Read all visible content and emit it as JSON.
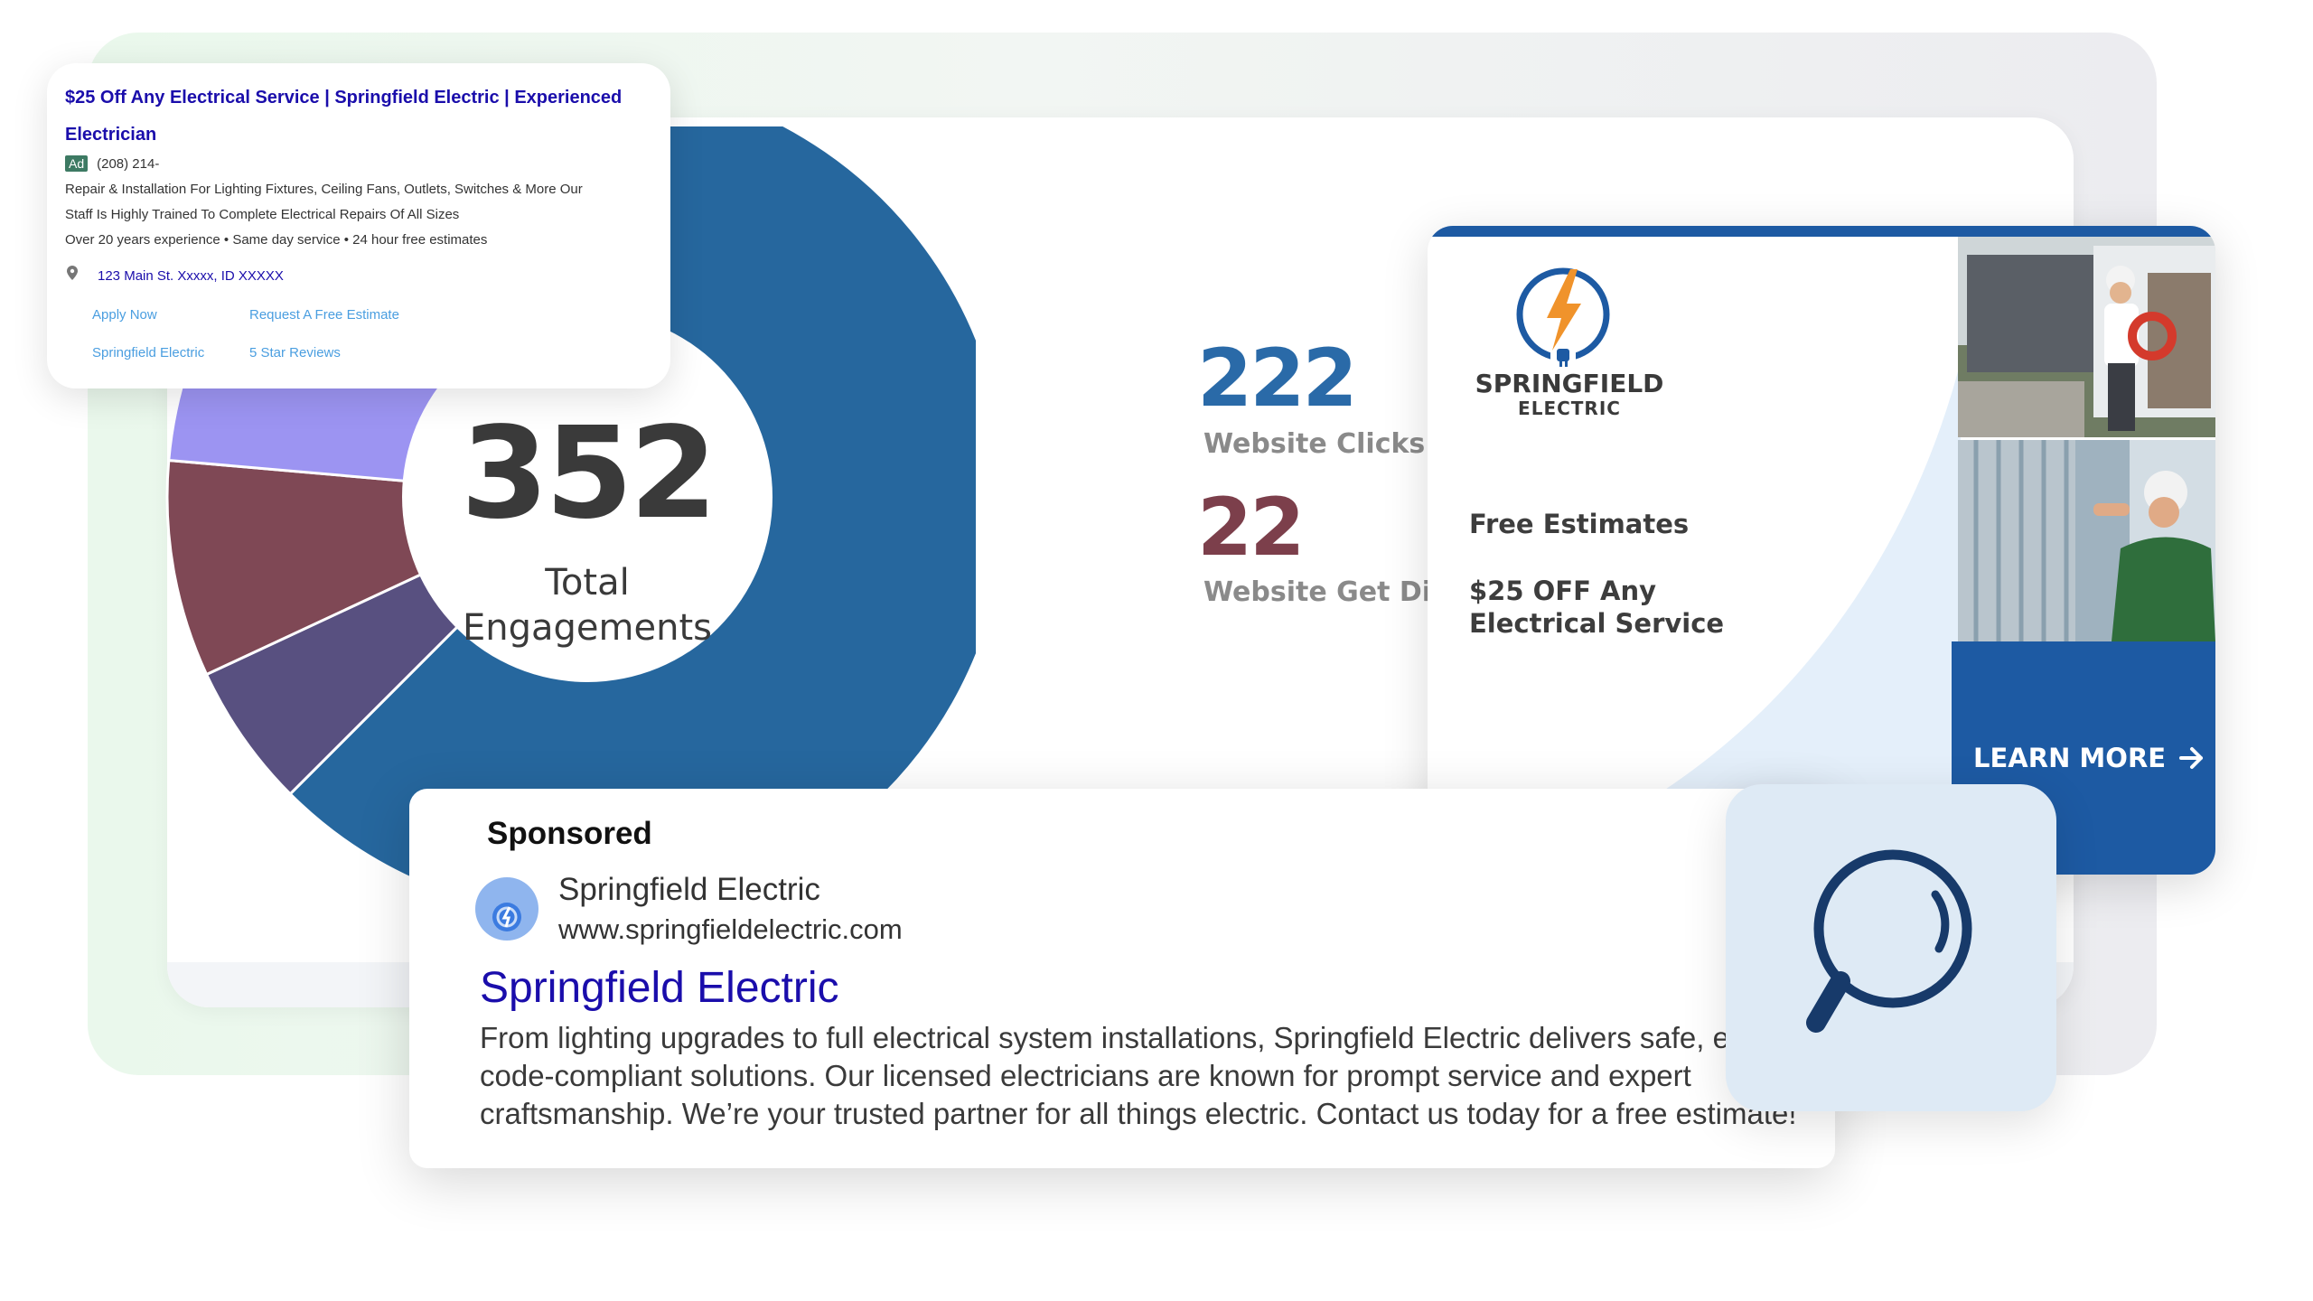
{
  "dashboard": {
    "total_engagements": {
      "value": "352",
      "label_line1": "Total",
      "label_line2": "Engagements"
    },
    "metrics": [
      {
        "value": "222",
        "label": "Website Clicks to",
        "color": "#2a6aa8"
      },
      {
        "value": "22",
        "label": "Website Get Direc",
        "color": "#7c3f4b"
      }
    ],
    "donut_colors": [
      "#26679e",
      "#9c94f2",
      "#7f4855",
      "#585080"
    ]
  },
  "text_ad": {
    "title": "$25 Off Any Electrical Service | Springfield Electric | Experienced Electrician",
    "ad_badge": "Ad",
    "phone": "(208) 214-",
    "desc_line1": "Repair & Installation For Lighting Fixtures, Ceiling Fans, Outlets, Switches & More Our",
    "desc_line2": "Staff Is Highly Trained To Complete Electrical Repairs Of All Sizes",
    "desc_line3": "Over 20 years experience • Same day service • 24 hour free estimates",
    "address": "123 Main St. Xxxxx, ID XXXXX",
    "sitelinks": [
      "Apply Now",
      "Request A Free Estimate",
      "Springfield Electric",
      "5 Star Reviews"
    ]
  },
  "banner_ad": {
    "brand_name": "SPRINGFIELD",
    "brand_sub": "ELECTRIC",
    "line1": "Free Estimates",
    "line2a": "$25 OFF Any",
    "line2b": "Electrical Service",
    "cta": "LEARN MORE",
    "accent_color": "#1d5aa3"
  },
  "sponsored_ad": {
    "label": "Sponsored",
    "name": "Springfield Electric",
    "url": "www.springfieldelectric.com",
    "title": "Springfield Electric",
    "description": "From lighting upgrades to full electrical system installations, Springfield Electric delivers safe, effi and code-compliant solutions. Our licensed electricians are known for prompt service and expert craftsmanship. We’re your trusted partner for all things electric. Contact us today for a free estimate!"
  }
}
